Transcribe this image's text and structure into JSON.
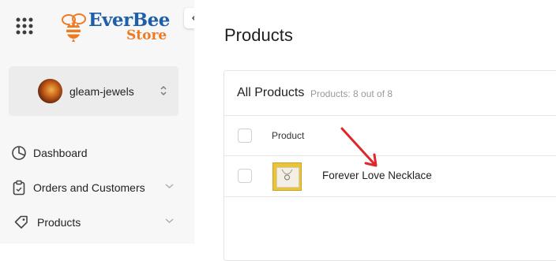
{
  "brand": {
    "line1": "EverBee",
    "line2": "Store",
    "color_blue": "#1e5fa8",
    "color_orange": "#f07a22"
  },
  "sidebar": {
    "store": {
      "name": "gleam-jewels"
    },
    "items": [
      {
        "label": "Dashboard",
        "icon": "pie-chart-icon",
        "has_chevron": false
      },
      {
        "label": "Orders and Customers",
        "icon": "clipboard-icon",
        "has_chevron": true
      },
      {
        "label": "Products",
        "icon": "tag-icon",
        "has_chevron": true
      }
    ]
  },
  "main": {
    "title": "Products",
    "card": {
      "title": "All Products",
      "count_text": "Products: 8 out of 8",
      "columns": [
        "Product"
      ],
      "rows": [
        {
          "name": "Forever Love Necklace"
        }
      ]
    }
  },
  "annotation": {
    "arrow_color": "#e0262b"
  }
}
